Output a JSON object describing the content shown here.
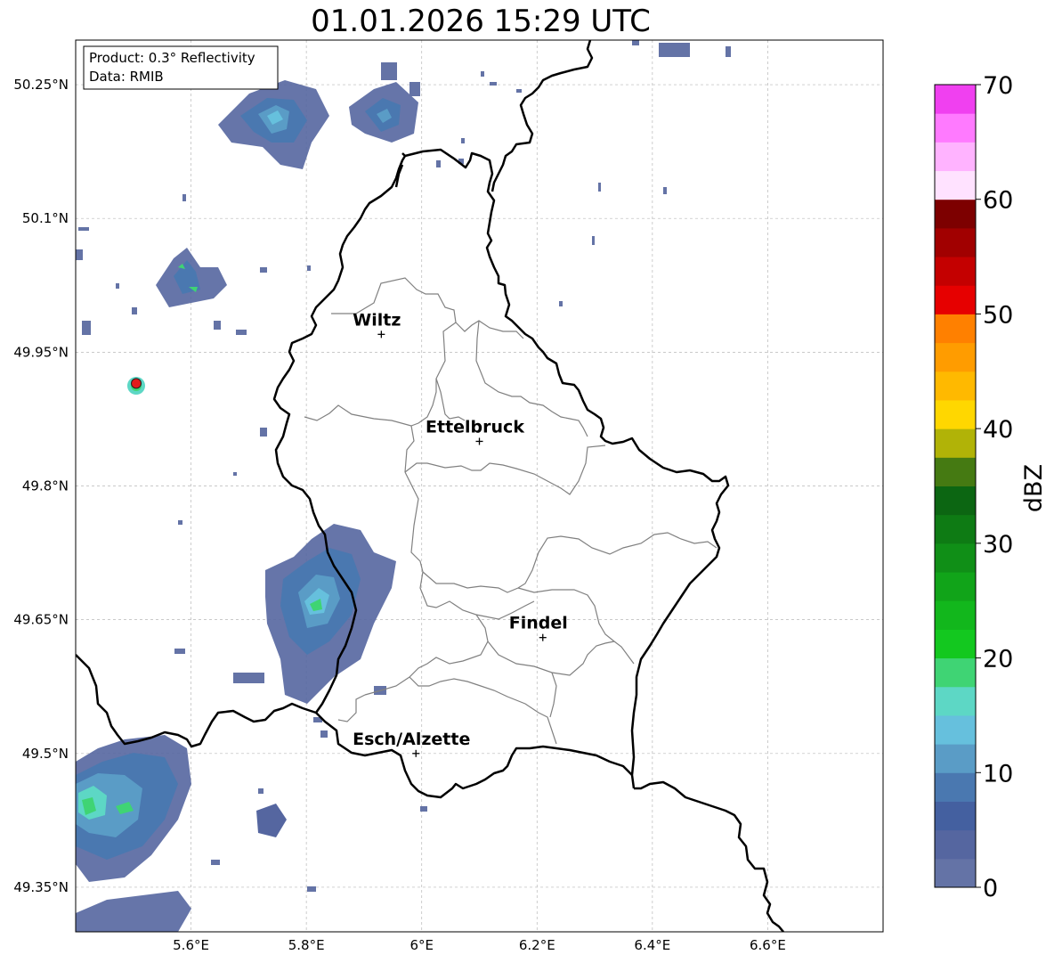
{
  "title": "01.01.2026 15:29 UTC",
  "info_box": {
    "product": "Product: 0.3° Reflectivity",
    "source": "Data: RMIB"
  },
  "axes": {
    "lon_ticks": [
      "5.6°E",
      "5.8°E",
      "6°E",
      "6.2°E",
      "6.4°E",
      "6.6°E"
    ],
    "lat_ticks": [
      "50.25°N",
      "50.1°N",
      "49.95°N",
      "49.8°N",
      "49.65°N",
      "49.5°N",
      "49.35°N"
    ],
    "lon_values": [
      5.6,
      5.8,
      6.0,
      6.2,
      6.4,
      6.6
    ],
    "lat_values": [
      50.25,
      50.1,
      49.95,
      49.8,
      49.65,
      49.5,
      49.35
    ],
    "lon_range": [
      5.4,
      6.8
    ],
    "lat_range": [
      49.3,
      50.3
    ],
    "grid": true
  },
  "cities": [
    {
      "name": "Wiltz",
      "lon": 5.93,
      "lat": 49.97
    },
    {
      "name": "Ettelbruck",
      "lon": 6.1,
      "lat": 49.85
    },
    {
      "name": "Findel",
      "lon": 6.21,
      "lat": 49.63
    },
    {
      "name": "Esch/Alzette",
      "lon": 5.99,
      "lat": 49.5
    }
  ],
  "radar_site": {
    "lon": 5.505,
    "lat": 49.915,
    "color": "#e31a1c"
  },
  "colorbar": {
    "label": "dBZ",
    "ticks": [
      "0",
      "10",
      "20",
      "30",
      "40",
      "50",
      "60",
      "70"
    ],
    "min": 0,
    "max": 70,
    "step": 2.5,
    "colors": [
      "#6473a6",
      "#5566a0",
      "#4460a0",
      "#4a78b0",
      "#5a9cc6",
      "#66c0dd",
      "#5dd7c5",
      "#3fd474",
      "#13c81f",
      "#12b71c",
      "#11a419",
      "#108f17",
      "#0e7b14",
      "#0c6612",
      "#457a12",
      "#b1b307",
      "#ffd700",
      "#ffb900",
      "#ff9c00",
      "#ff8000",
      "#e60000",
      "#c40000",
      "#a10000",
      "#7d0000",
      "#ffe2ff",
      "#ffb3ff",
      "#ff7aff",
      "#f040f0"
    ]
  }
}
